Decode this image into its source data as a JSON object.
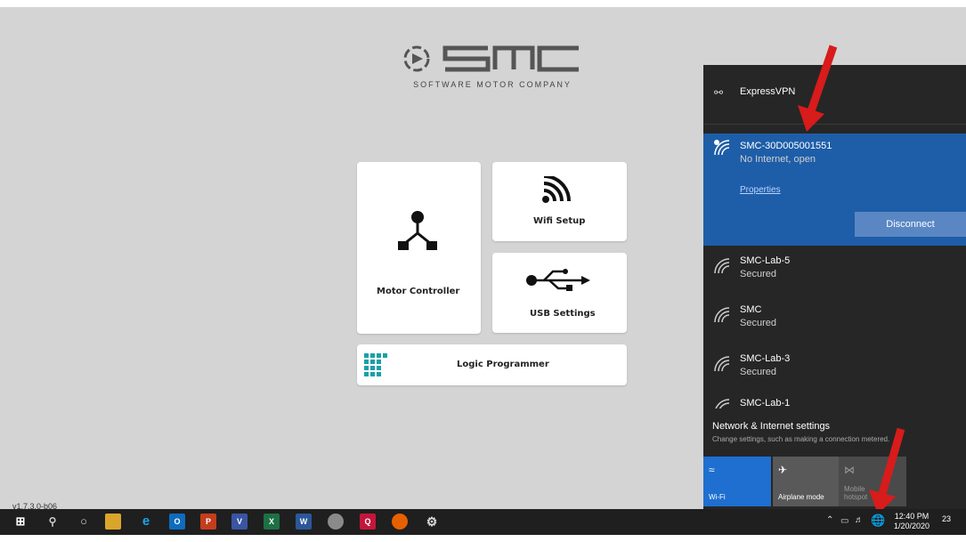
{
  "app": {
    "logo_name": "SMC",
    "logo_tagline": "SOFTWARE MOTOR COMPANY",
    "version": "v1.7.3.0-b06",
    "tiles": {
      "motor_controller": "Motor Controller",
      "wifi_setup": "Wifi Setup",
      "usb_settings": "USB Settings",
      "logic_programmer": "Logic Programmer"
    }
  },
  "network_panel": {
    "vpn": "ExpressVPN",
    "selected": {
      "name": "SMC-30D005001551",
      "status": "No Internet, open",
      "properties_link": "Properties",
      "disconnect_button": "Disconnect"
    },
    "networks": [
      {
        "name": "SMC-Lab-5",
        "status": "Secured"
      },
      {
        "name": "SMC",
        "status": "Secured"
      },
      {
        "name": "SMC-Lab-3",
        "status": "Secured"
      },
      {
        "name": "SMC-Lab-1",
        "status": ""
      }
    ],
    "settings_title": "Network & Internet settings",
    "settings_sub": "Change settings, such as making a connection metered.",
    "quick_actions": [
      {
        "label": "Wi-Fi",
        "icon": "wifi-icon",
        "active": true
      },
      {
        "label": "Airplane mode",
        "icon": "airplane-icon",
        "active": false
      },
      {
        "label": "Mobile hotspot",
        "icon": "hotspot-icon",
        "active": false
      }
    ]
  },
  "taskbar": {
    "time": "12:40 PM",
    "date": "1/20/2020",
    "notification_count": "23"
  },
  "colors": {
    "selected_network": "#1e5ea8",
    "panel_bg": "#262626",
    "arrow": "#d81b1b",
    "tile_teal": "#1aa0a8"
  }
}
